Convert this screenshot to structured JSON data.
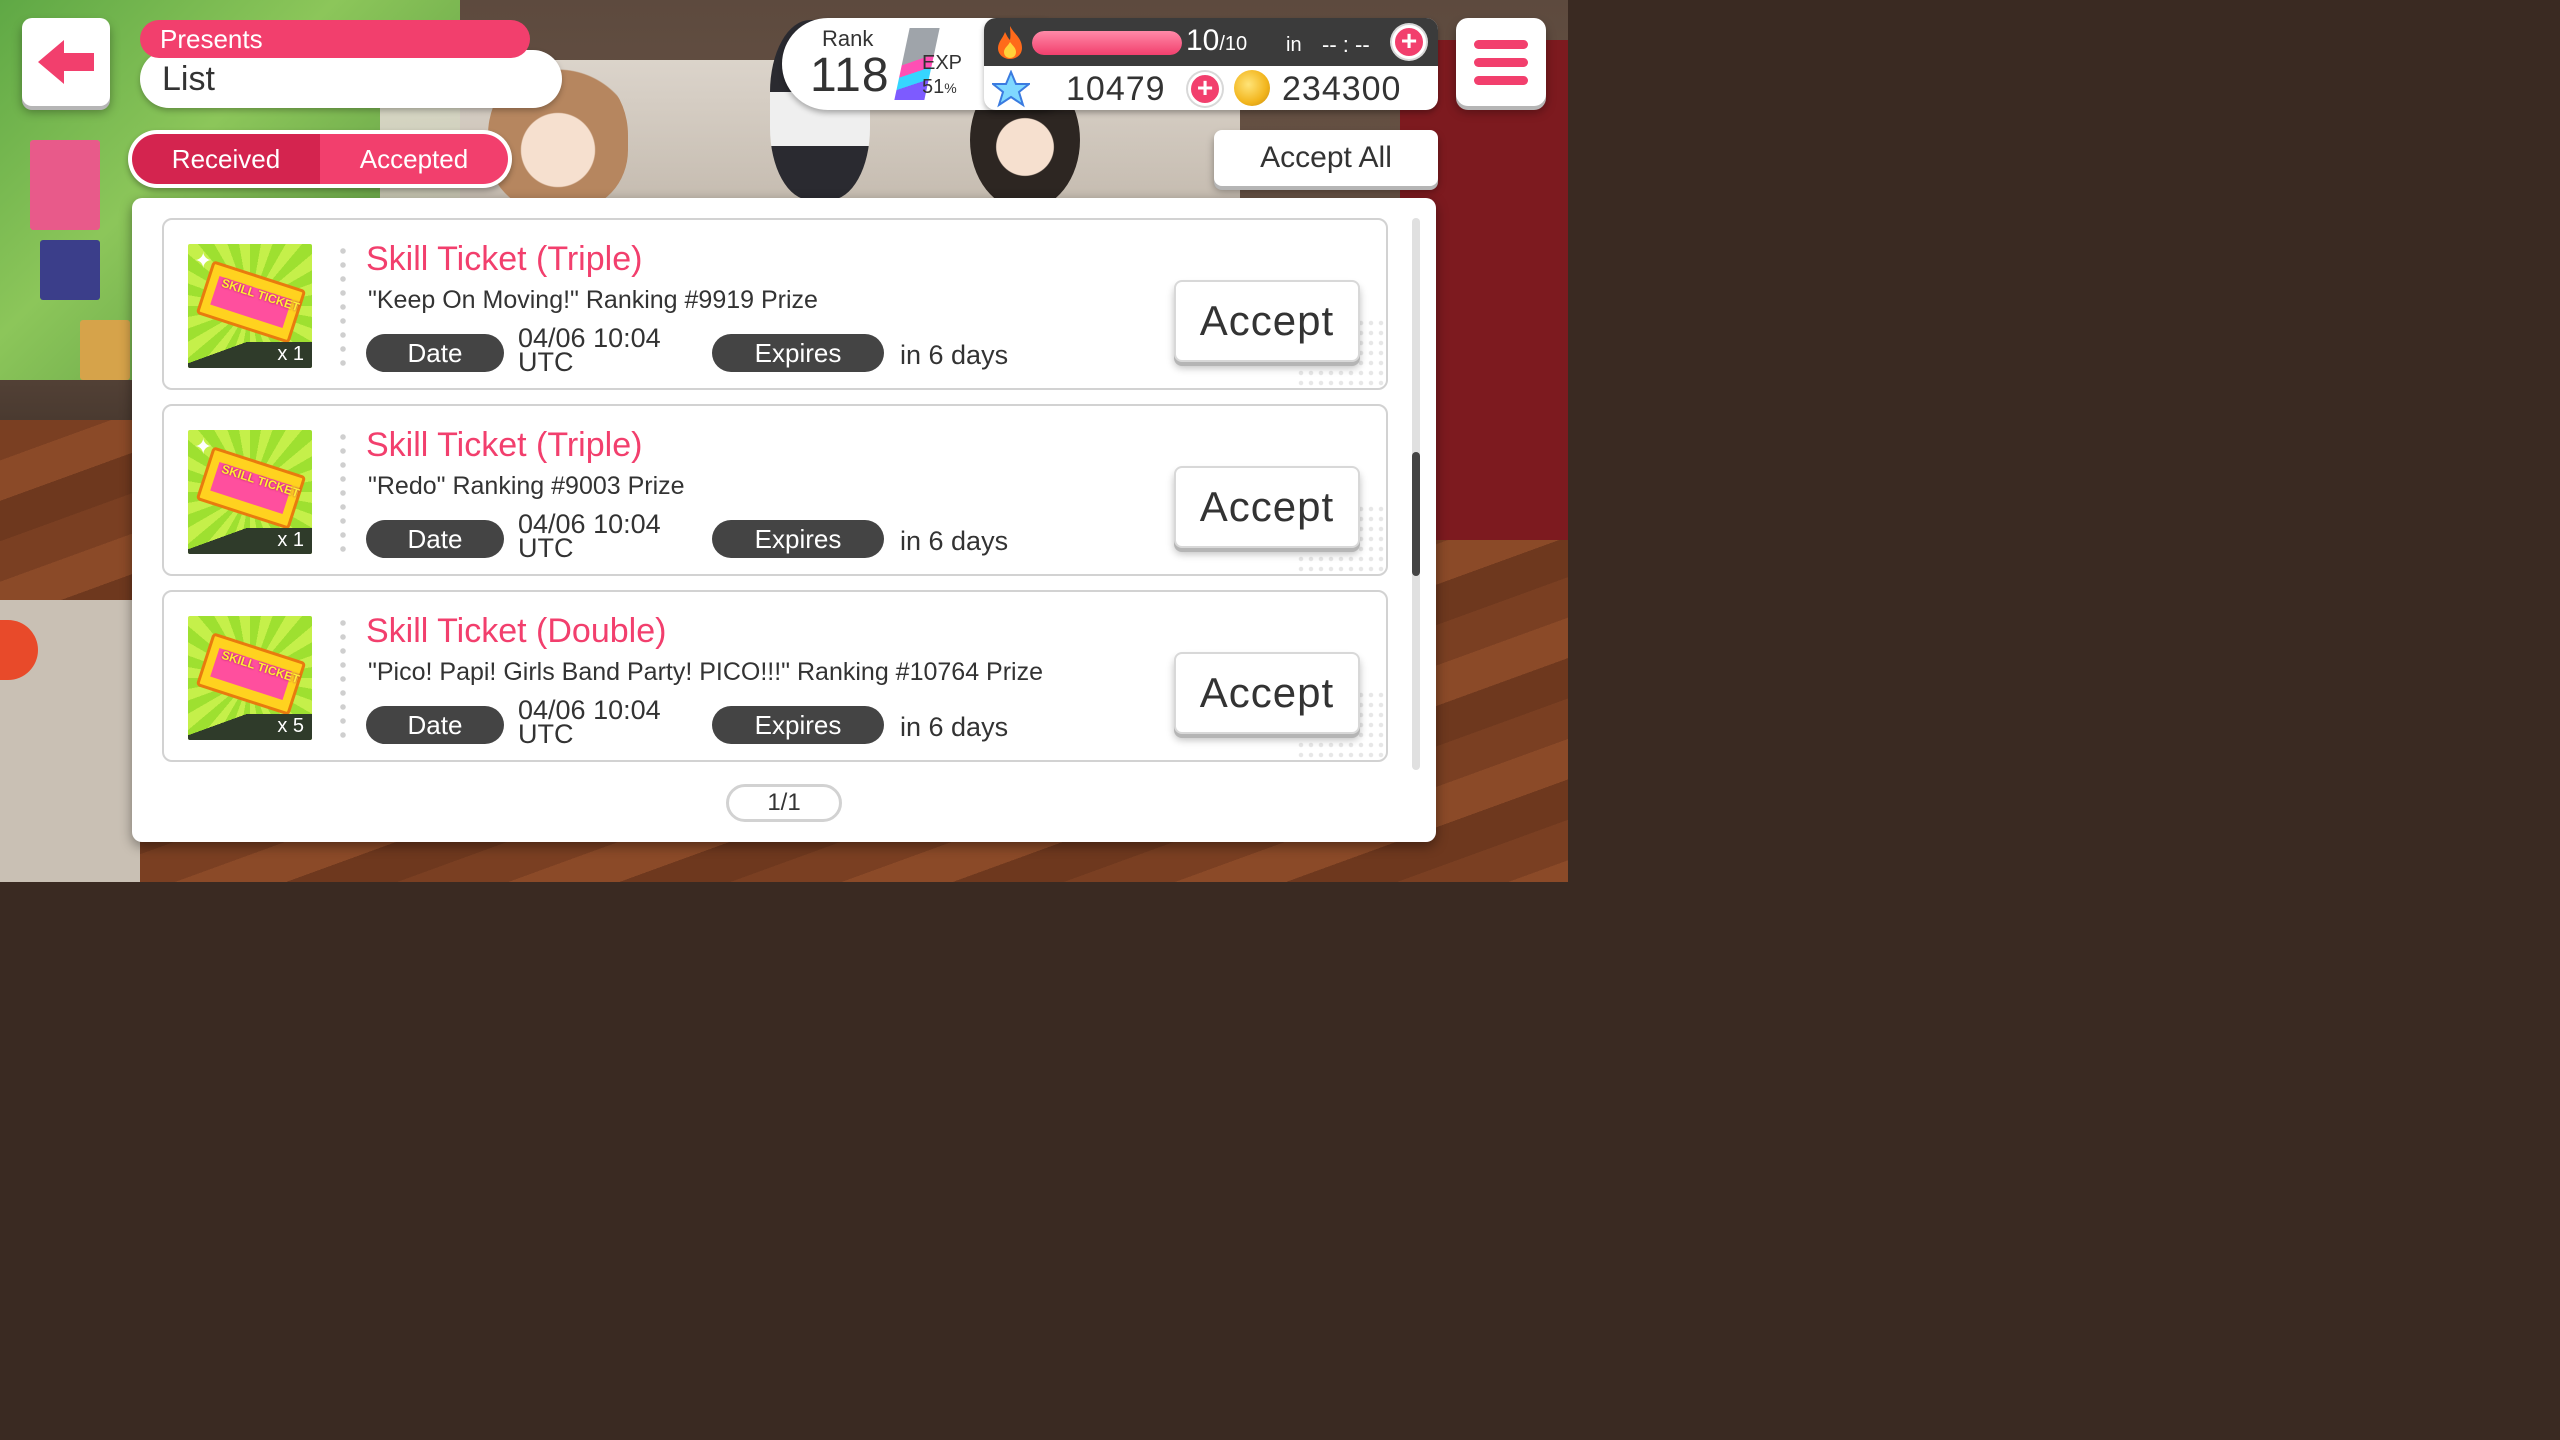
{
  "header": {
    "section_label": "Presents",
    "section_title": "List",
    "tabs": [
      {
        "label": "Received",
        "active": true
      },
      {
        "label": "Accepted",
        "active": false
      }
    ],
    "accept_all_label": "Accept All"
  },
  "status": {
    "rank_label": "Rank",
    "rank_value": "118",
    "exp_label": "EXP",
    "exp_value": "51",
    "exp_unit": "%",
    "stamina_current": "10",
    "stamina_max": "/10",
    "stamina_fraction": 1.0,
    "stamina_in_label": "in",
    "stamina_timer": "-- : --",
    "star_gems": "10479",
    "coins": "234300"
  },
  "presents": [
    {
      "title": "Skill Ticket (Triple)",
      "description": "\"Keep On Moving!\" Ranking #9919 Prize",
      "quantity": "x 1",
      "date_label": "Date",
      "date_value": "04/06 10:04",
      "date_tz": "UTC",
      "expires_label": "Expires",
      "expires_value": "in 6 days",
      "accept_label": "Accept"
    },
    {
      "title": "Skill Ticket (Triple)",
      "description": "\"Redo\" Ranking #9003 Prize",
      "quantity": "x 1",
      "date_label": "Date",
      "date_value": "04/06 10:04",
      "date_tz": "UTC",
      "expires_label": "Expires",
      "expires_value": "in 6 days",
      "accept_label": "Accept"
    },
    {
      "title": "Skill Ticket (Double)",
      "description": "\"Pico! Papi! Girls Band Party! PICO!!!\" Ranking #10764 Prize",
      "quantity": "x 5",
      "date_label": "Date",
      "date_value": "04/06 10:04",
      "date_tz": "UTC",
      "expires_label": "Expires",
      "expires_value": "in 6 days",
      "accept_label": "Accept"
    }
  ],
  "ticket_art": {
    "triple_text": "SKILL TICKET",
    "double_text": "SKILL TICKET"
  },
  "pager": "1/1",
  "colors": {
    "accent_pink": "#f23f6d",
    "dark_pill": "#444444",
    "ticket_green": "#9ee030"
  },
  "icons": [
    "back-arrow-icon",
    "menu-icon",
    "flame-icon",
    "star-icon",
    "coin-icon",
    "plus-icon",
    "sparkle-icon"
  ]
}
